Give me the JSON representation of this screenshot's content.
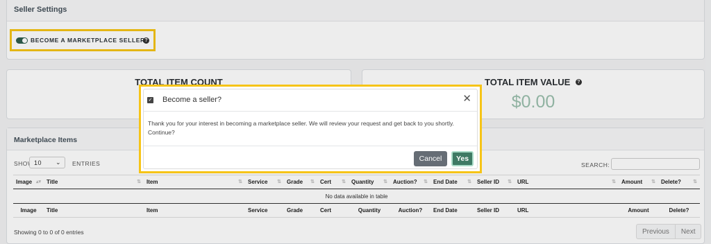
{
  "seller_settings": {
    "title": "Seller Settings",
    "toggle_label": "BECOME A MARKETPLACE SELLER?",
    "help_glyph": "?"
  },
  "stats": {
    "count_title": "TOTAL ITEM COUNT",
    "value_title": "TOTAL ITEM VALUE",
    "value": "$0.00",
    "help_glyph": "?"
  },
  "items": {
    "title": "Marketplace Items",
    "show_label": "SHOW",
    "entries_value": "10",
    "entries_label": "ENTRIES",
    "search_label": "SEARCH:",
    "search_value": "",
    "columns": [
      "Image",
      "Title",
      "Item",
      "Service",
      "Grade",
      "Cert",
      "Quantity",
      "Auction?",
      "End Date",
      "Seller ID",
      "URL",
      "Amount",
      "Delete?"
    ],
    "empty_message": "No data available in table",
    "info": "Showing 0 to 0 of 0 entries",
    "pager": {
      "previous": "Previous",
      "next": "Next"
    }
  },
  "modal": {
    "title": "Become a seller?",
    "body": "Thank you for your interest in becoming a marketplace seller. We will review your request and get back to you shortly. Continue?",
    "cancel_label": "Cancel",
    "yes_label": "Yes",
    "close_glyph": "✕",
    "check_glyph": "✓"
  },
  "colors": {
    "accent_green": "#3e7a64",
    "highlight_yellow": "#f6c417",
    "stat_value": "#9bc0ae"
  }
}
